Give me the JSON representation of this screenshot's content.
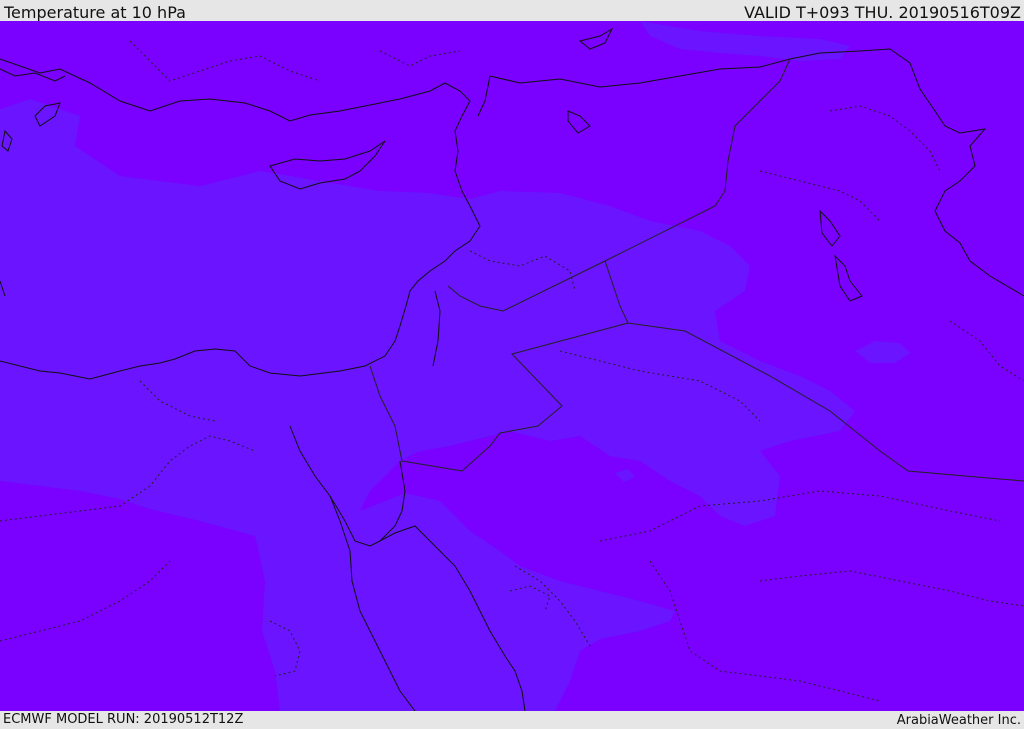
{
  "header": {
    "title": "Temperature at 10 hPa",
    "valid_time": "VALID T+093 THU. 20190516T09Z"
  },
  "footer": {
    "model_run": "ECMWF MODEL RUN: 20190512T12Z",
    "credit": "ArabiaWeather Inc."
  },
  "map": {
    "field": "temperature",
    "level": "10 hPa",
    "colors": {
      "background_band": "#7a00ff",
      "warmer_band": "#6a14ff",
      "warm_spot": "#6c1ef6",
      "coastline": "#111111",
      "border": "#222222"
    }
  }
}
